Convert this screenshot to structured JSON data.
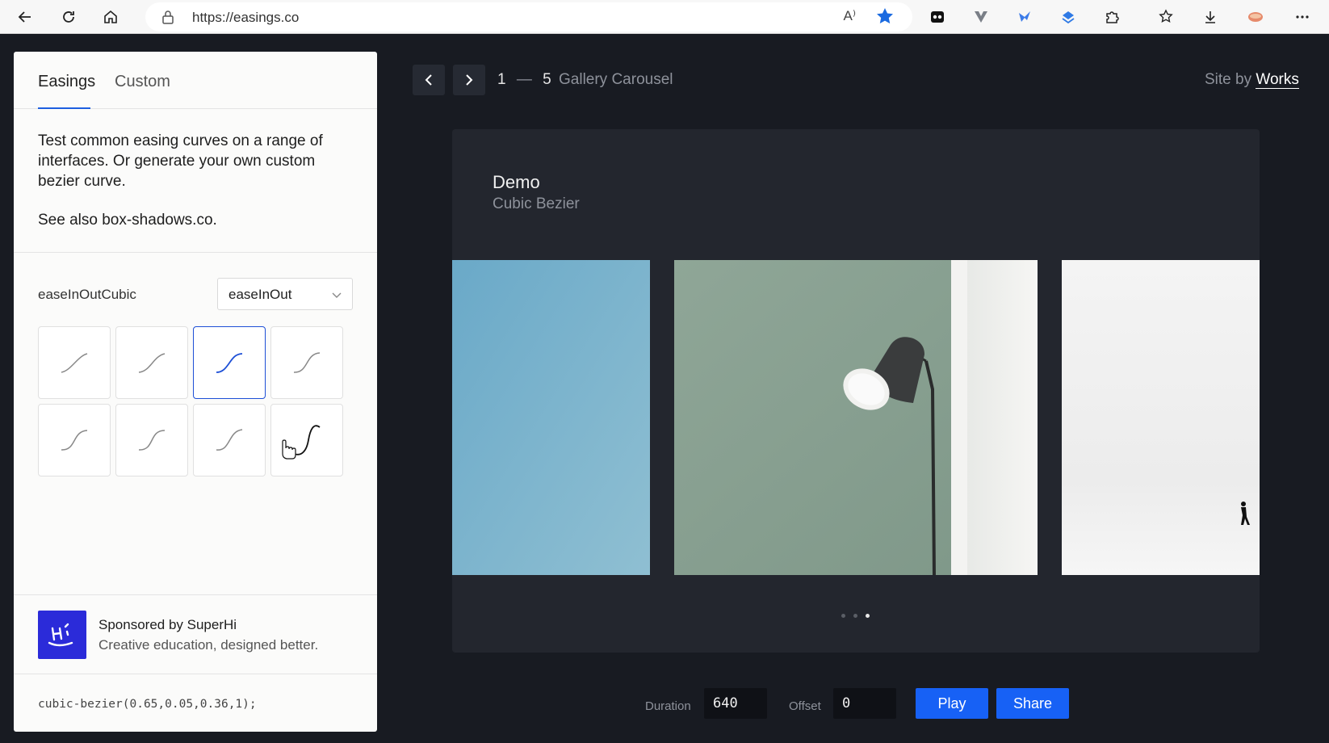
{
  "browser": {
    "url": "https://easings.co",
    "reader_label": "A⁾"
  },
  "panel": {
    "tabs": [
      {
        "label": "Easings",
        "active": true
      },
      {
        "label": "Custom",
        "active": false
      }
    ],
    "intro": "Test common easing curves on a range of interfaces. Or generate your own custom bezier curve.",
    "see_also": "See also box-shadows.co.",
    "easing_name": "easeInOutCubic",
    "easing_type_select": {
      "value": "easeInOut"
    },
    "curve_options": [
      {
        "name": "ease-in-out-sine"
      },
      {
        "name": "ease-in-out-quad"
      },
      {
        "name": "ease-in-out-cubic",
        "selected": true
      },
      {
        "name": "ease-in-out-quart"
      },
      {
        "name": "ease-in-out-quint"
      },
      {
        "name": "ease-in-out-expo"
      },
      {
        "name": "ease-in-out-circ"
      },
      {
        "name": "ease-in-out-back"
      }
    ],
    "sponsor": {
      "title": "Sponsored by SuperHi",
      "subtitle": "Creative education, designed better."
    },
    "code": "cubic-bezier(0.65,0.05,0.36,1);"
  },
  "header": {
    "counter_current": "1",
    "counter_sep": "—",
    "counter_total": "5",
    "demo_name": "Gallery Carousel",
    "credit_prefix": "Site by",
    "credit_link": "Works"
  },
  "stage": {
    "title": "Demo",
    "subtitle": "Cubic Bezier",
    "active_dot": 3
  },
  "controls": {
    "duration_label": "Duration",
    "duration_value": "640",
    "offset_label": "Offset",
    "offset_value": "0",
    "play_label": "Play",
    "share_label": "Share"
  },
  "colors": {
    "accent": "#1761f5",
    "selected_curve": "#1d4fd6",
    "background": "#181b22"
  }
}
